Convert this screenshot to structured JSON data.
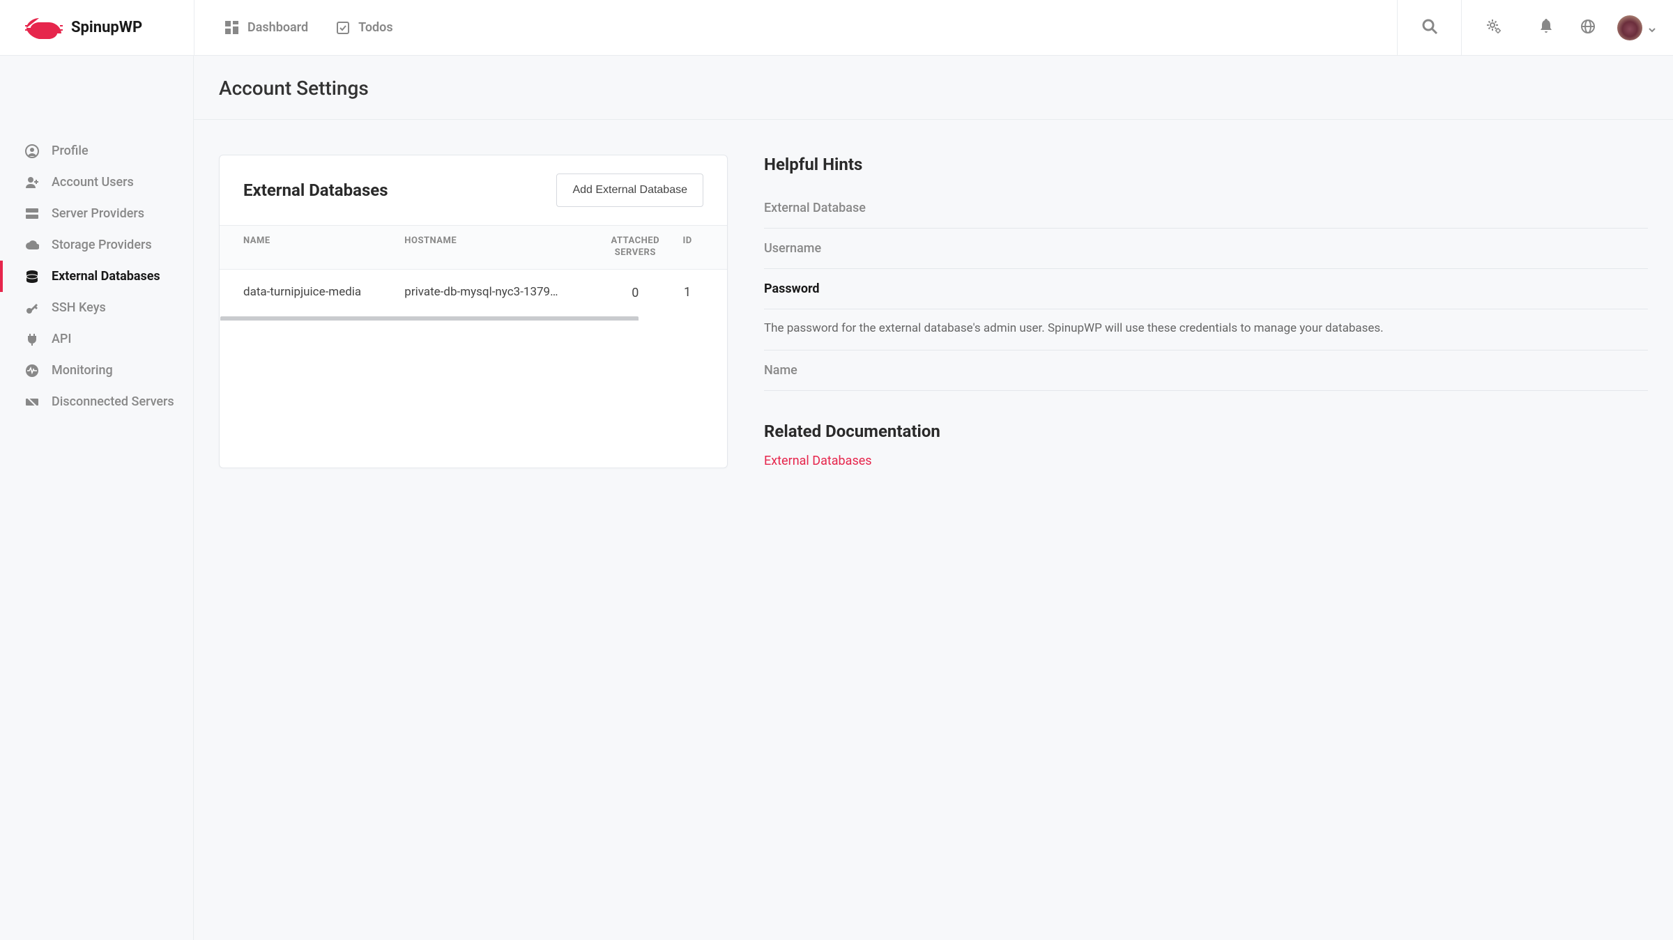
{
  "brand": "SpinupWP",
  "topnav": {
    "dashboard": "Dashboard",
    "todos": "Todos"
  },
  "page_title": "Account Settings",
  "sidebar": {
    "items": [
      {
        "label": "Profile",
        "icon": "user-circle"
      },
      {
        "label": "Account Users",
        "icon": "user-plus"
      },
      {
        "label": "Server Providers",
        "icon": "server"
      },
      {
        "label": "Storage Providers",
        "icon": "cloud"
      },
      {
        "label": "External Databases",
        "icon": "database",
        "active": true
      },
      {
        "label": "SSH Keys",
        "icon": "key"
      },
      {
        "label": "API",
        "icon": "plug"
      },
      {
        "label": "Monitoring",
        "icon": "heartbeat"
      },
      {
        "label": "Disconnected Servers",
        "icon": "server-off"
      }
    ]
  },
  "card": {
    "title": "External Databases",
    "add_label": "Add External Database",
    "columns": {
      "name": "NAME",
      "hostname": "HOSTNAME",
      "attached": "ATTACHED SERVERS",
      "id": "ID"
    },
    "rows": [
      {
        "name": "data-turnipjuice-media",
        "hostname": "private-db-mysql-nyc3-1379…",
        "attached": "0",
        "id": "1"
      }
    ]
  },
  "hints": {
    "title": "Helpful Hints",
    "items": [
      {
        "label": "External Database",
        "expanded": false
      },
      {
        "label": "Username",
        "expanded": false
      },
      {
        "label": "Password",
        "expanded": true,
        "body": "The password for the external database's admin user. SpinupWP will use these credentials to manage your databases."
      },
      {
        "label": "Name",
        "expanded": false
      }
    ],
    "related_title": "Related Documentation",
    "doc_link": "External Databases"
  }
}
